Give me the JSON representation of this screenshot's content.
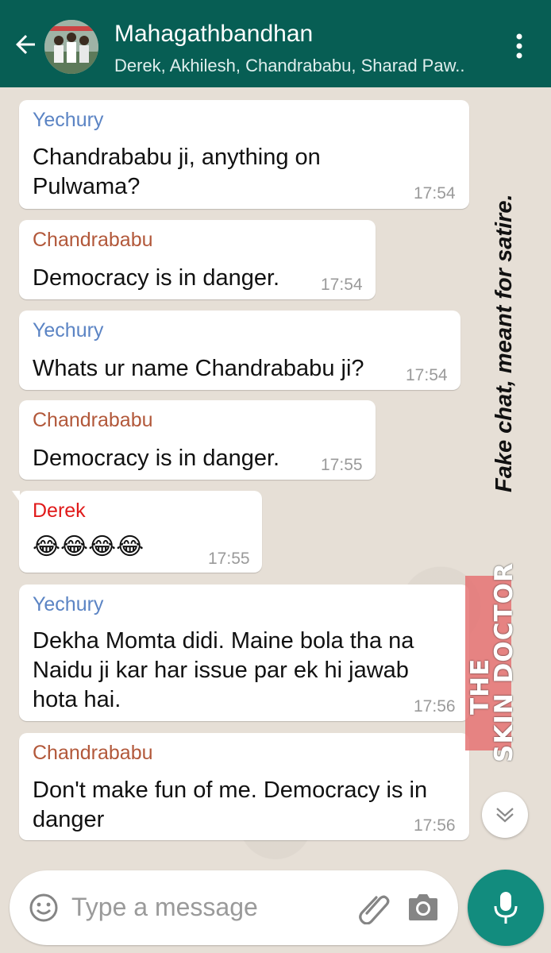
{
  "header": {
    "title": "Mahagathbandhan",
    "subtitle": "Derek, Akhilesh, Chandrababu, Sharad Paw.."
  },
  "colors": {
    "header_bg": "#075e54",
    "yechury": "#5b84c4",
    "chandrababu": "#b2583a",
    "derek": "#e01a1a",
    "mic_button": "#128c7e"
  },
  "messages": [
    {
      "sender": "Yechury",
      "lines": [
        "Chandrababu ji, anything on",
        "Pulwama?"
      ],
      "time": "17:54"
    },
    {
      "sender": "Chandrababu",
      "lines": [
        "Democracy is in danger."
      ],
      "time": "17:54"
    },
    {
      "sender": "Yechury",
      "lines": [
        "Whats ur name Chandrababu ji?"
      ],
      "time": "17:54"
    },
    {
      "sender": "Chandrababu",
      "lines": [
        "Democracy is in danger."
      ],
      "time": "17:55"
    },
    {
      "sender": "Derek",
      "lines": [
        "😂😂😂😂"
      ],
      "time": "17:55"
    },
    {
      "sender": "Yechury",
      "lines": [
        "Dekha Momta didi. Maine bola tha na",
        "Naidu ji kar har issue par ek hi jawab",
        "hota hai."
      ],
      "time": "17:56"
    },
    {
      "sender": "Chandrababu",
      "lines": [
        "Don't make fun of me. Democracy is in",
        "danger"
      ],
      "time": "17:56"
    }
  ],
  "overlay": {
    "note": "Fake chat, meant for satire.",
    "watermark_line1": "THE",
    "watermark_line2": "SKIN DOCTOR"
  },
  "input": {
    "placeholder": "Type a message"
  },
  "icons": [
    "back-arrow-icon",
    "more-vert-icon",
    "emoji-icon",
    "attach-icon",
    "camera-icon",
    "mic-icon",
    "chevron-down-icon"
  ]
}
